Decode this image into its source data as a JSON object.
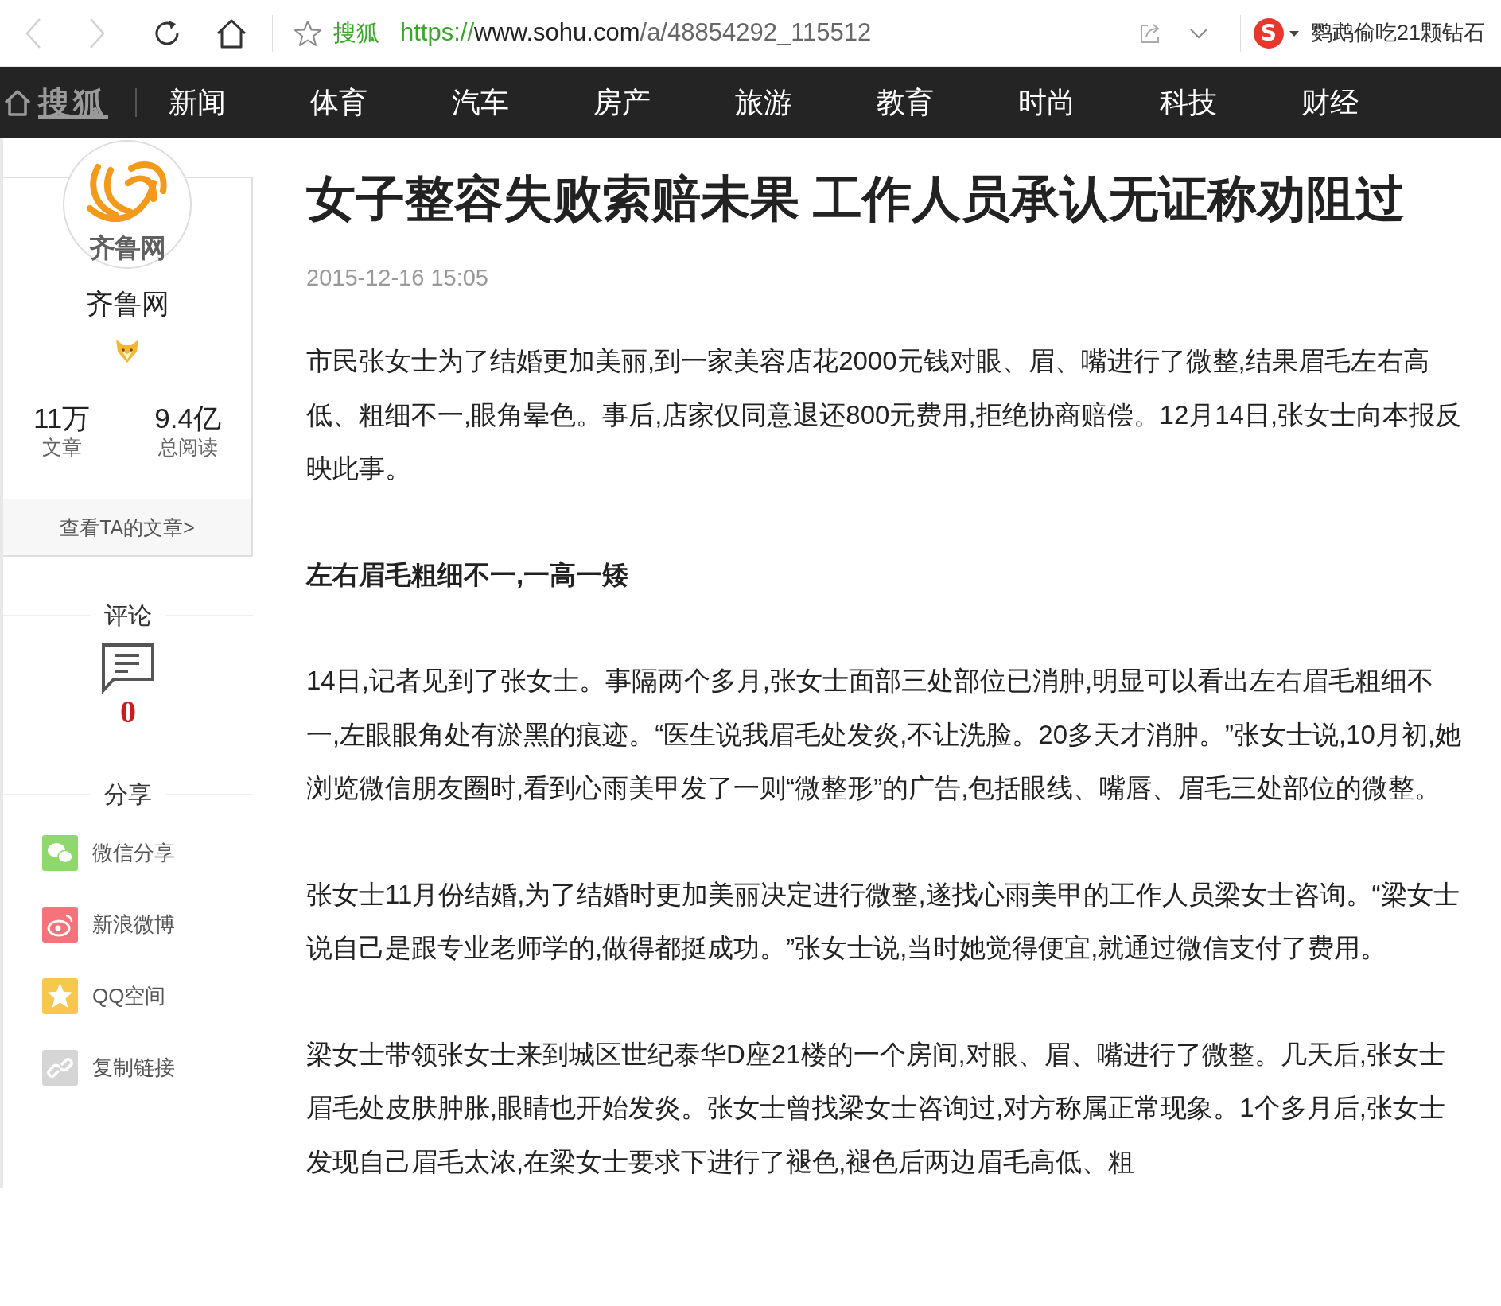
{
  "browser": {
    "back": {
      "disabled": true
    },
    "forward": {
      "disabled": true
    },
    "site_label": "搜狐",
    "url": {
      "scheme": "https://",
      "host": "www.sohu.com",
      "path": "/a/48854292_115512"
    },
    "search_logo": "S",
    "hot_search": "鹦鹉偷吃21颗钻石"
  },
  "nav": {
    "logo": "搜狐",
    "items": [
      "新闻",
      "体育",
      "汽车",
      "房产",
      "旅游",
      "教育",
      "时尚",
      "科技",
      "财经"
    ]
  },
  "author": {
    "avatar_text": "齐鲁网",
    "name": "齐鲁网",
    "stats": [
      {
        "value": "11万",
        "label": "文章"
      },
      {
        "value": "9.4亿",
        "label": "总阅读"
      }
    ],
    "link": "查看TA的文章>"
  },
  "comments": {
    "heading": "评论",
    "count": "0"
  },
  "share": {
    "heading": "分享",
    "items": [
      {
        "kind": "wechat",
        "label": "微信分享",
        "color": "#8fd86c"
      },
      {
        "kind": "weibo",
        "label": "新浪微博",
        "color": "#f7737b"
      },
      {
        "kind": "qzone",
        "label": "QQ空间",
        "color": "#f8c74e"
      },
      {
        "kind": "link",
        "label": "复制链接",
        "color": "#d5d5d5"
      }
    ]
  },
  "article": {
    "title": "女子整容失败索赔未果 工作人员承认无证称劝阻过",
    "date": "2015-12-16 15:05",
    "blocks": [
      {
        "kind": "paragraph",
        "text": "市民张女士为了结婚更加美丽,到一家美容店花2000元钱对眼、眉、嘴进行了微整,结果眉毛左右高低、粗细不一,眼角晕色。事后,店家仅同意退还800元费用,拒绝协商赔偿。12月14日,张女士向本报反映此事。"
      },
      {
        "kind": "subheading",
        "text": "左右眉毛粗细不一,一高一矮"
      },
      {
        "kind": "paragraph",
        "text": "14日,记者见到了张女士。事隔两个多月,张女士面部三处部位已消肿,明显可以看出左右眉毛粗细不一,左眼眼角处有淤黑的痕迹。“医生说我眉毛处发炎,不让洗脸。20多天才消肿。”张女士说,10月初,她浏览微信朋友圈时,看到心雨美甲发了一则“微整形”的广告,包括眼线、嘴唇、眉毛三处部位的微整。"
      },
      {
        "kind": "paragraph",
        "text": "张女士11月份结婚,为了结婚时更加美丽决定进行微整,遂找心雨美甲的工作人员梁女士咨询。“梁女士说自己是跟专业老师学的,做得都挺成功。”张女士说,当时她觉得便宜,就通过微信支付了费用。"
      },
      {
        "kind": "paragraph",
        "text": "梁女士带领张女士来到城区世纪泰华D座21楼的一个房间,对眼、眉、嘴进行了微整。几天后,张女士眉毛处皮肤肿胀,眼睛也开始发炎。张女士曾找梁女士咨询过,对方称属正常现象。1个多月后,张女士发现自己眉毛太浓,在梁女士要求下进行了褪色,褪色后两边眉毛高低、粗"
      }
    ]
  }
}
